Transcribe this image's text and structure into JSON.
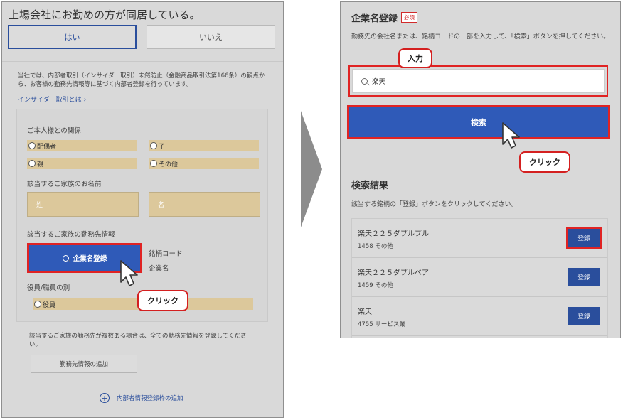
{
  "left": {
    "title": "上場会社にお勤めの方が同居している。",
    "yes_label": "はい",
    "no_label": "いいえ",
    "note": "当社では、内部者取引（インサイダー取引）未然防止（金融商品取引法第166条）の観点から、お客様の勤務先情報等に基づく内部者登録を行っています。",
    "insider_link": "インサイダー取引とは",
    "relation_label": "ご本人様との関係",
    "options": [
      "配偶者",
      "子",
      "親",
      "その他"
    ],
    "family_name_label": "該当するご家族のお名前",
    "last_name_placeholder": "姓",
    "first_name_placeholder": "名",
    "workplace_label": "該当するご家族の勤務先情報",
    "company_search_button": "企業名登録",
    "brand_code_label": "銘柄コード",
    "company_name_label": "企業名",
    "position_label": "役員/職員の別",
    "position_option": "役員",
    "multi_note": "該当するご家族の勤務先が複数ある場合は、全ての勤務先情報を登録してください。",
    "add_workplace_button": "勤務先情報の追加",
    "add_frame_link": "内部者情報登録枠の追加",
    "plus_glyph": "+",
    "click_callout": "クリック"
  },
  "right": {
    "title": "企業名登録",
    "required_badge": "必須",
    "instruction": "勤務先の会社名または、銘柄コードの一部を入力して、「検索」ボタンを押してください。",
    "input_callout": "入力",
    "search_value": "楽天",
    "search_button": "検索",
    "click_callout": "クリック",
    "results_title": "検索結果",
    "results_instruction": "該当する銘柄の「登録」ボタンをクリックしてください。",
    "results": [
      {
        "name": "楽天２２５ダブルブル",
        "sub": "1458 その他",
        "button": "登録"
      },
      {
        "name": "楽天２２５ダブルベア",
        "sub": "1459 その他",
        "button": "登録"
      },
      {
        "name": "楽天",
        "sub": "4755 サービス業",
        "button": "登録"
      }
    ]
  },
  "colors": {
    "accent_blue": "#2f5ab8",
    "highlight_red": "#e02323",
    "option_tan": "#dcc89b"
  }
}
